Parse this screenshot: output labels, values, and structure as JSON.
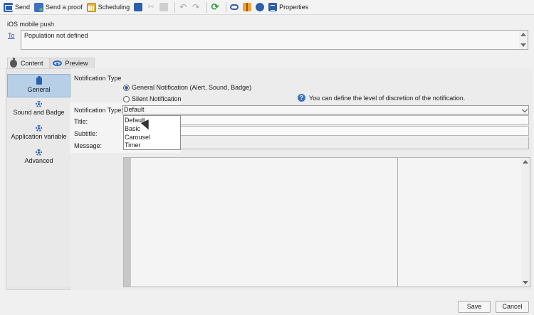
{
  "toolbar": {
    "send": "Send",
    "send_proof": "Send a proof",
    "scheduling": "Scheduling",
    "properties": "Properties"
  },
  "header": {
    "section_title": "iOS mobile push",
    "to_link": "To",
    "population_text": "Population not defined"
  },
  "tabs": [
    {
      "label": "Content",
      "icon": "apple-icon",
      "active": true
    },
    {
      "label": "Preview",
      "icon": "eye-icon",
      "active": false
    }
  ],
  "left_nav": [
    {
      "label": "General",
      "icon": "general-icon",
      "selected": true
    },
    {
      "label": "Sound and Badge",
      "icon": "gear-icon"
    },
    {
      "label": "Application variable",
      "icon": "gear-icon"
    },
    {
      "label": "Advanced",
      "icon": "gear-icon"
    }
  ],
  "form": {
    "notification_type_heading": "Notification Type",
    "radio_general": "General Notification (Alert, Sound, Badge)",
    "radio_silent": "Silent Notification",
    "info_text": "You can define the level of discretion of the notification.",
    "notification_type_label": "Notification Type:",
    "notification_type_value": "Default",
    "title_label": "Title:",
    "subtitle_label": "Subtitle:",
    "message_label": "Message:"
  },
  "dropdown_options": [
    "Default",
    "Basic",
    "Carousel",
    "Timer"
  ],
  "footer": {
    "save": "Save",
    "cancel": "Cancel"
  },
  "colors": {
    "accent": "#2b5fb0",
    "nav_selected": "#b7d0e8",
    "link": "#2456b8"
  }
}
